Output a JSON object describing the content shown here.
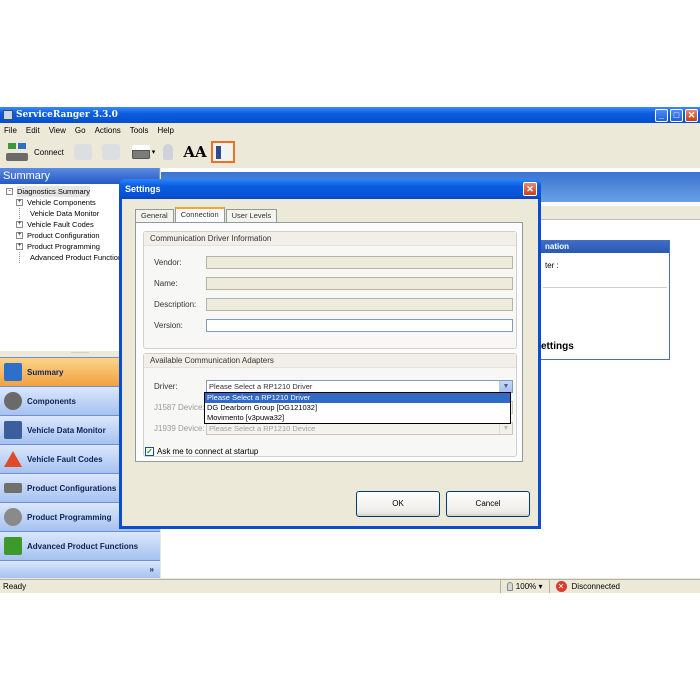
{
  "app": {
    "title": "ServiceRanger 3.3.0",
    "menu": [
      "File",
      "Edit",
      "View",
      "Go",
      "Actions",
      "Tools",
      "Help"
    ],
    "toolbar": {
      "connect_label": "Connect",
      "font_label": "AA"
    }
  },
  "left": {
    "header": "Summary",
    "tree": [
      {
        "label": "Diagnostics Summary",
        "expander": "-",
        "level": 0
      },
      {
        "label": "Vehicle Components",
        "expander": "+",
        "level": 1
      },
      {
        "label": "Vehicle Data Monitor",
        "expander": "",
        "level": 1
      },
      {
        "label": "Vehicle Fault Codes",
        "expander": "+",
        "level": 1
      },
      {
        "label": "Product Configuration",
        "expander": "+",
        "level": 1
      },
      {
        "label": "Product Programming",
        "expander": "+",
        "level": 1
      },
      {
        "label": "Advanced Product Functions",
        "expander": "",
        "level": 1
      }
    ],
    "nav": [
      {
        "label": "Summary",
        "icon": "summary-icon",
        "color": "#2f6fcc"
      },
      {
        "label": "Components",
        "icon": "components-icon",
        "color": "#6a6a6a"
      },
      {
        "label": "Vehicle Data Monitor",
        "icon": "monitor-icon",
        "color": "#3a5f9c"
      },
      {
        "label": "Vehicle Fault Codes",
        "icon": "warning-icon",
        "color": "#e04a2a"
      },
      {
        "label": "Product Configurations",
        "icon": "config-icon",
        "color": "#707070"
      },
      {
        "label": "Product Programming",
        "icon": "programming-icon",
        "color": "#8a8a8a"
      },
      {
        "label": "Advanced Product Functions",
        "icon": "advanced-icon",
        "color": "#3d9a2a"
      }
    ],
    "more": "»"
  },
  "right": {
    "info_title": "nation",
    "info_line": "ter :",
    "settings_title": "ettings"
  },
  "status": {
    "ready": "Ready",
    "zoom": "100%",
    "connection": "Disconnected"
  },
  "dialog": {
    "title": "Settings",
    "tabs": [
      "General",
      "Connection",
      "User Levels"
    ],
    "active_tab": "Connection",
    "driver_info": {
      "title": "Communication Driver Information",
      "vendor_label": "Vendor:",
      "name_label": "Name:",
      "description_label": "Description:",
      "version_label": "Version:",
      "vendor_value": "",
      "name_value": "",
      "description_value": "",
      "version_value": ""
    },
    "adapters": {
      "title": "Available Communication Adapters",
      "driver_label": "Driver:",
      "driver_value": "Please Select a RP1210 Driver",
      "j1587_label": "J1587 Device:",
      "j1939_label": "J1939 Device:",
      "j1939_value": "Please Select a RP1210 Device",
      "options": [
        "Please Select a RP1210 Driver",
        "DG Dearborn Group [DG121032]",
        "Movimento [v3puwa32]"
      ],
      "selected_index": 0
    },
    "checkbox_label": "Ask me to connect at startup",
    "checkbox_checked": true,
    "ok_label": "OK",
    "cancel_label": "Cancel"
  }
}
